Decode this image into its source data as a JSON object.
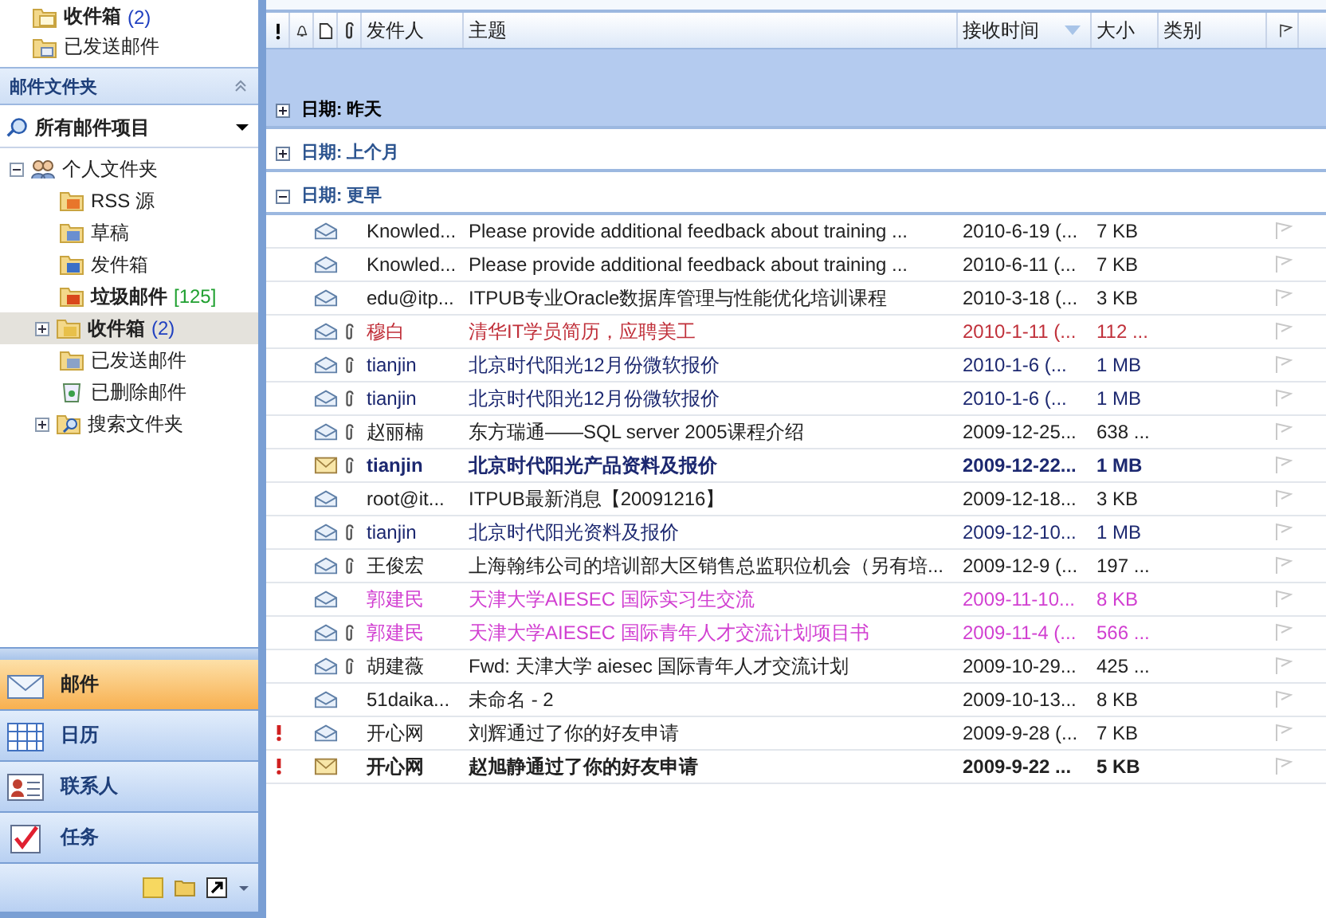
{
  "favorites": [
    {
      "kind": "inbox",
      "label": "收件箱",
      "count": "(2)"
    },
    {
      "kind": "sent",
      "label": "已发送邮件"
    }
  ],
  "folder_pane": {
    "title": "邮件文件夹",
    "view_dropdown": "所有邮件项目"
  },
  "tree": [
    {
      "kind": "personal",
      "label": "个人文件夹",
      "expanded": true,
      "selected": false,
      "children": [
        {
          "kind": "rss",
          "label": "RSS 源",
          "selected": false
        },
        {
          "kind": "drafts",
          "label": "草稿",
          "selected": false
        },
        {
          "kind": "outbox",
          "label": "发件箱",
          "selected": false
        },
        {
          "kind": "junk",
          "label": "垃圾邮件",
          "count": "[125]",
          "selected": false
        },
        {
          "kind": "inbox",
          "label": "收件箱",
          "count": "(2)",
          "expanded": false,
          "selected": true
        },
        {
          "kind": "sent",
          "label": "已发送邮件",
          "selected": false
        },
        {
          "kind": "deleted",
          "label": "已删除邮件",
          "selected": false
        },
        {
          "kind": "search",
          "label": "搜索文件夹",
          "expanded": false,
          "selected": false
        }
      ]
    }
  ],
  "nav_buttons": [
    {
      "kind": "mail",
      "label": "邮件",
      "selected": true
    },
    {
      "kind": "calendar",
      "label": "日历",
      "selected": false
    },
    {
      "kind": "contacts",
      "label": "联系人",
      "selected": false
    },
    {
      "kind": "tasks",
      "label": "任务",
      "selected": false
    }
  ],
  "table": {
    "columns": [
      "发件人",
      "主题",
      "接收时间",
      "大小",
      "类别"
    ],
    "groups": [
      {
        "label": "日期: 昨天",
        "expanded": false,
        "selected": true
      },
      {
        "label": "日期: 上个月",
        "expanded": false,
        "selected": false
      },
      {
        "label": "日期: 更早",
        "expanded": true,
        "selected": false
      }
    ],
    "rows": [
      {
        "sender": "Knowled...",
        "subject": "Please provide additional feedback about training ...",
        "received": "2010-6-19 (...",
        "size": "7 KB",
        "important": false,
        "unread": false,
        "attachment": false,
        "color": "#222222"
      },
      {
        "sender": "Knowled...",
        "subject": "Please provide additional feedback about training ...",
        "received": "2010-6-11 (...",
        "size": "7 KB",
        "important": false,
        "unread": false,
        "attachment": false,
        "color": "#222222"
      },
      {
        "sender": "edu@itp...",
        "subject": "ITPUB专业Oracle数据库管理与性能优化培训课程",
        "received": "2010-3-18 (...",
        "size": "3 KB",
        "important": false,
        "unread": false,
        "attachment": false,
        "color": "#222222"
      },
      {
        "sender": "穆白",
        "subject": "清华IT学员简历，应聘美工",
        "received": "2010-1-11 (...",
        "size": "112 ...",
        "important": false,
        "unread": false,
        "attachment": true,
        "color": "#c0303a"
      },
      {
        "sender": "tianjin",
        "subject": "北京时代阳光12月份微软报价",
        "received": "2010-1-6 (...",
        "size": "1 MB",
        "important": false,
        "unread": false,
        "attachment": true,
        "color": "#1c2870"
      },
      {
        "sender": "tianjin",
        "subject": "北京时代阳光12月份微软报价",
        "received": "2010-1-6 (...",
        "size": "1 MB",
        "important": false,
        "unread": false,
        "attachment": true,
        "color": "#1c2870"
      },
      {
        "sender": "赵丽楠",
        "subject": "东方瑞通——SQL server 2005课程介绍",
        "received": "2009-12-25...",
        "size": "638 ...",
        "important": false,
        "unread": false,
        "attachment": true,
        "color": "#222222"
      },
      {
        "sender": "tianjin",
        "subject": "北京时代阳光产品资料及报价",
        "received": "2009-12-22...",
        "size": "1 MB",
        "important": false,
        "unread": true,
        "attachment": true,
        "color": "#1c2870"
      },
      {
        "sender": "root@it...",
        "subject": "ITPUB最新消息【20091216】",
        "received": "2009-12-18...",
        "size": "3 KB",
        "important": false,
        "unread": false,
        "attachment": false,
        "color": "#222222"
      },
      {
        "sender": "tianjin",
        "subject": "北京时代阳光资料及报价",
        "received": "2009-12-10...",
        "size": "1 MB",
        "important": false,
        "unread": false,
        "attachment": true,
        "color": "#1c2870"
      },
      {
        "sender": "王俊宏",
        "subject": "上海翰纬公司的培训部大区销售总监职位机会（另有培...",
        "received": "2009-12-9 (...",
        "size": "197 ...",
        "important": false,
        "unread": false,
        "attachment": true,
        "color": "#222222"
      },
      {
        "sender": "郭建民",
        "subject": "天津大学AIESEC 国际实习生交流",
        "received": "2009-11-10...",
        "size": "8 KB",
        "important": false,
        "unread": false,
        "attachment": false,
        "color": "#d13fd1"
      },
      {
        "sender": "郭建民",
        "subject": "天津大学AIESEC 国际青年人才交流计划项目书",
        "received": "2009-11-4 (...",
        "size": "566 ...",
        "important": false,
        "unread": false,
        "attachment": true,
        "color": "#d13fd1"
      },
      {
        "sender": "胡建薇",
        "subject": "Fwd: 天津大学 aiesec 国际青年人才交流计划",
        "received": "2009-10-29...",
        "size": "425 ...",
        "important": false,
        "unread": false,
        "attachment": true,
        "color": "#222222"
      },
      {
        "sender": "51daika...",
        "subject": "未命名 - 2",
        "received": "2009-10-13...",
        "size": "8 KB",
        "important": false,
        "unread": false,
        "attachment": false,
        "color": "#222222"
      },
      {
        "sender": "开心网",
        "subject": "刘辉通过了你的好友申请",
        "received": "2009-9-28 (...",
        "size": "7 KB",
        "important": true,
        "unread": false,
        "attachment": false,
        "color": "#222222"
      },
      {
        "sender": "开心网",
        "subject": "赵旭静通过了你的好友申请",
        "received": "2009-9-22 ...",
        "size": "5 KB",
        "important": true,
        "unread": true,
        "attachment": false,
        "color": "#222222"
      }
    ]
  }
}
